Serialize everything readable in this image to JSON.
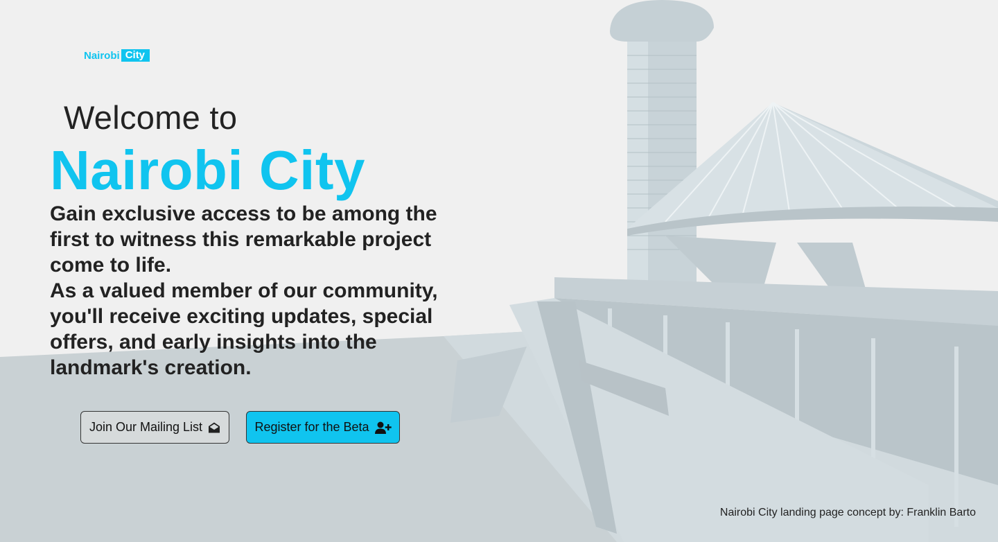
{
  "brand": {
    "part1": "Nairobi",
    "part2": "City"
  },
  "hero": {
    "welcome": "Welcome to",
    "title": "Nairobi City",
    "paragraph1": "Gain exclusive access to be among the first to witness this remarkable project come to life.",
    "paragraph2": "As a valued member of our community, you'll receive exciting updates, special offers, and early insights into the landmark's creation."
  },
  "buttons": {
    "mailing": {
      "label": "Join Our Mailing List",
      "icon": "envelope-open-icon"
    },
    "beta": {
      "label": "Register for the Beta",
      "icon": "user-plus-icon"
    }
  },
  "credit": "Nairobi City landing page concept by: Franklin Barto",
  "colors": {
    "accent": "#10c4ef",
    "background": "#f0f0f0",
    "text": "#222222"
  }
}
